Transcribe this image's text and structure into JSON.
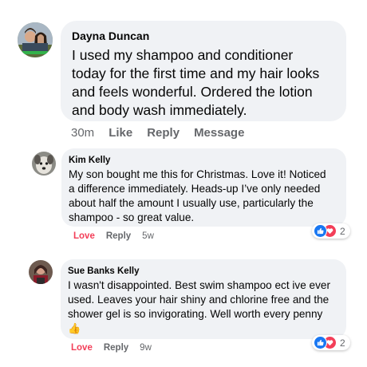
{
  "colors": {
    "bubble_bg": "#f0f2f5",
    "muted_text": "#65676b",
    "love_red": "#f33e58",
    "like_blue": "#1877f2"
  },
  "comments": [
    {
      "author": "Dayna Duncan",
      "text_lines": [
        "I used my shampoo and conditioner",
        "today for the first time and my hair looks",
        "and feels wonderful. Ordered the lotion",
        "and body wash immediately."
      ],
      "actions": {
        "time": "30m",
        "like": "Like",
        "reply": "Reply",
        "message": "Message"
      }
    },
    {
      "author": "Kim Kelly",
      "text_lines": [
        "My son bought me this for Christmas. Love it! Noticed",
        "a difference immediately. Heads-up I’ve only needed",
        "about half the amount I usually use, particularly the",
        "shampoo - so great value."
      ],
      "actions": {
        "love": "Love",
        "reply": "Reply",
        "time": "5w"
      },
      "reactions": {
        "icons": [
          "like-icon",
          "love-icon"
        ],
        "count": "2"
      }
    },
    {
      "author": "Sue Banks Kelly",
      "text_lines": [
        "I wasn't disappointed. Best swim shampoo ect ive ever",
        "used. Leaves your hair shiny and chlorine free and the",
        "shower gel is so invigorating. Well worth every penny"
      ],
      "emoji": "👍",
      "actions": {
        "love": "Love",
        "reply": "Reply",
        "time": "9w"
      },
      "reactions": {
        "icons": [
          "like-icon",
          "love-icon"
        ],
        "count": "2"
      }
    }
  ]
}
